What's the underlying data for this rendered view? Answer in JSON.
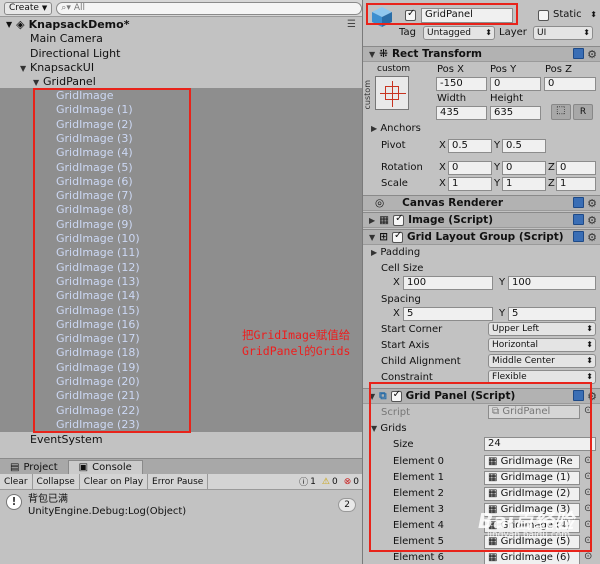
{
  "hierarchy": {
    "create_label": "Create",
    "search_placeholder": "All",
    "scene_name": "KnapsackDemo*",
    "items": {
      "main_camera": "Main Camera",
      "directional_light": "Directional Light",
      "knapsack_ui": "KnapsackUI",
      "grid_panel": "GridPanel",
      "event_system": "EventSystem"
    },
    "children": [
      "GridImage",
      "GridImage (1)",
      "GridImage (2)",
      "GridImage (3)",
      "GridImage (4)",
      "GridImage (5)",
      "GridImage (6)",
      "GridImage (7)",
      "GridImage (8)",
      "GridImage (9)",
      "GridImage (10)",
      "GridImage (11)",
      "GridImage (12)",
      "GridImage (13)",
      "GridImage (14)",
      "GridImage (15)",
      "GridImage (16)",
      "GridImage (17)",
      "GridImage (18)",
      "GridImage (19)",
      "GridImage (20)",
      "GridImage (21)",
      "GridImage (22)",
      "GridImage (23)"
    ]
  },
  "annotation": {
    "line1": "把GridImage赋值给",
    "line2": "GridPanel的Grids"
  },
  "bottom": {
    "tab_project": "Project",
    "tab_console": "Console",
    "buttons": {
      "clear": "Clear",
      "collapse": "Collapse",
      "clear_on_play": "Clear on Play",
      "error_pause": "Error Pause"
    },
    "counts": {
      "info": "1",
      "warn": "0",
      "error": "0"
    },
    "log_line1": "背包已满",
    "log_line2": "UnityEngine.Debug:Log(Object)",
    "log_count": "2"
  },
  "inspector": {
    "object_name": "GridPanel",
    "static_label": "Static",
    "tag_label": "Tag",
    "tag_value": "Untagged",
    "layer_label": "Layer",
    "layer_value": "UI",
    "rect_transform": {
      "title": "Rect Transform",
      "custom": "custom",
      "custom_vertical": "custom",
      "pos_x_label": "Pos X",
      "pos_y_label": "Pos Y",
      "pos_z_label": "Pos Z",
      "pos_x": "-150",
      "pos_y": "0",
      "pos_z": "0",
      "width_label": "Width",
      "height_label": "Height",
      "width": "435",
      "height": "635",
      "r_label": "R",
      "anchors_label": "Anchors",
      "pivot_label": "Pivot",
      "pivot_x": "0.5",
      "pivot_y": "0.5",
      "rotation_label": "Rotation",
      "rot_x": "0",
      "rot_y": "0",
      "rot_z": "0",
      "scale_label": "Scale",
      "scale_x": "1",
      "scale_y": "1",
      "scale_z": "1",
      "x": "X",
      "y": "Y",
      "z": "Z"
    },
    "canvas_renderer": {
      "title": "Canvas Renderer"
    },
    "image_script": {
      "title": "Image (Script)"
    },
    "grid_layout": {
      "title": "Grid Layout Group (Script)",
      "padding_label": "Padding",
      "cell_size_label": "Cell Size",
      "cell_x": "100",
      "cell_y": "100",
      "spacing_label": "Spacing",
      "spacing_x": "5",
      "spacing_y": "5",
      "start_corner_label": "Start Corner",
      "start_corner": "Upper Left",
      "start_axis_label": "Start Axis",
      "start_axis": "Horizontal",
      "child_alignment_label": "Child Alignment",
      "child_alignment": "Middle Center",
      "constraint_label": "Constraint",
      "constraint": "Flexible"
    },
    "grid_panel_script": {
      "title": "Grid Panel (Script)",
      "script_label": "Script",
      "script_value": "GridPanel",
      "grids_label": "Grids",
      "size_label": "Size",
      "size_value": "24",
      "elements": [
        {
          "label": "Element 0",
          "value": "GridImage (Re"
        },
        {
          "label": "Element 1",
          "value": "GridImage (1)"
        },
        {
          "label": "Element 2",
          "value": "GridImage (2)"
        },
        {
          "label": "Element 3",
          "value": "GridImage (3)"
        },
        {
          "label": "Element 4",
          "value": "GridImage (4)"
        },
        {
          "label": "Element 5",
          "value": "GridImage (5)"
        },
        {
          "label": "Element 6",
          "value": "GridImage (6)"
        }
      ]
    }
  },
  "watermark": {
    "brand": "Bai百经验",
    "url": "jingyan.baidu.com"
  },
  "colors": {
    "highlight_red": "#e8231a",
    "child_text": "#ccd8f4",
    "selection_bg": "#8e8e8e"
  }
}
